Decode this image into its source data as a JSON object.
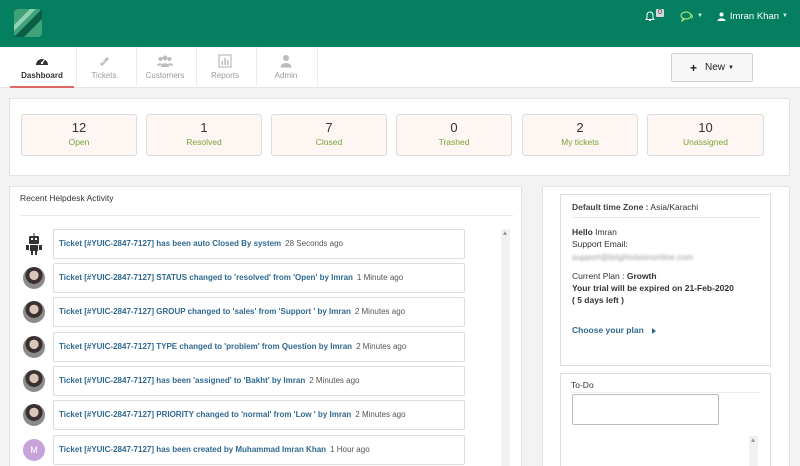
{
  "header": {
    "bell_count": "0",
    "user_name": "Imran Khan",
    "colors": {
      "brand": "#047f5f",
      "accent": "#e06666",
      "link": "#2f6990",
      "stat_label": "#7aa33a"
    },
    "icons": [
      "logo-icon",
      "bell-icon",
      "chat-icon",
      "user-icon"
    ]
  },
  "nav": {
    "tabs": [
      {
        "label": "Dashboard",
        "icon": "dashboard-icon",
        "active": true
      },
      {
        "label": "Tickets",
        "icon": "ticket-icon"
      },
      {
        "label": "Customers",
        "icon": "users-icon"
      },
      {
        "label": "Reports",
        "icon": "chart-icon"
      },
      {
        "label": "Admin",
        "icon": "user-icon"
      }
    ],
    "new_label": "New"
  },
  "stats": [
    {
      "value": "12",
      "label": "Open"
    },
    {
      "value": "1",
      "label": "Resolved"
    },
    {
      "value": "7",
      "label": "Closed"
    },
    {
      "value": "0",
      "label": "Trashed"
    },
    {
      "value": "2",
      "label": "My tickets"
    },
    {
      "value": "10",
      "label": "Unassigned"
    }
  ],
  "activity": {
    "title": "Recent Helpdesk Activity",
    "items": [
      {
        "avatar": "robot",
        "text": "Ticket [#YUIC-2847-7127] has been auto Closed By system",
        "time": "28 Seconds ago"
      },
      {
        "avatar": "photo",
        "text": "Ticket [#YUIC-2847-7127] STATUS changed to 'resolved' from 'Open' by Imran",
        "time": "1 Minute ago"
      },
      {
        "avatar": "photo",
        "text": "Ticket [#YUIC-2847-7127] GROUP changed to 'sales' from 'Support ' by Imran",
        "time": "2 Minutes ago"
      },
      {
        "avatar": "photo",
        "text": "Ticket [#YUIC-2847-7127] TYPE changed to 'problem' from Question by Imran",
        "time": "2 Minutes ago"
      },
      {
        "avatar": "photo",
        "text": "Ticket [#YUIC-2847-7127] has been 'assigned' to 'Bakht' by Imran",
        "time": "2 Minutes ago"
      },
      {
        "avatar": "photo",
        "text": "Ticket [#YUIC-2847-7127] PRIORITY changed to 'normal' from 'Low ' by Imran",
        "time": "2 Minutes ago"
      },
      {
        "avatar": "letter",
        "letter": "M",
        "text": "Ticket [#YUIC-2847-7127] has been created by Muhammad Imran Khan",
        "time": "1 Hour ago"
      }
    ]
  },
  "info": {
    "timezone_label": "Default time Zone :",
    "timezone_value": "Asia/Karachi",
    "hello_label": "Hello",
    "hello_name": "Imran",
    "support_email_label": "Support Email:",
    "support_email": "support@brightvisiononline.com",
    "plan_label": "Current Plan :",
    "plan_value": "Growth",
    "trial_text": "Your trial will be expired on 21-Feb-2020",
    "days_left": "( 5 days left )",
    "choose_plan": "Choose your plan"
  },
  "todo": {
    "title": "To-Do",
    "placeholder": ""
  }
}
